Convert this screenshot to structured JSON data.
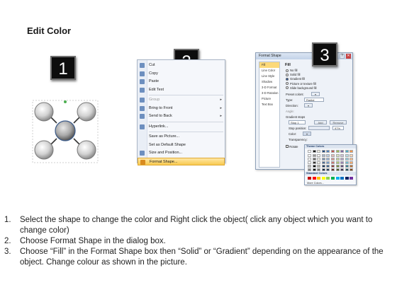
{
  "page": {
    "title": "Edit Color"
  },
  "steps": {
    "one": "1",
    "two": "2",
    "three": "3"
  },
  "context_menu": {
    "items": [
      {
        "label": "Cut",
        "icon": "scissors-icon",
        "arrow": false,
        "disabled": false,
        "highlight": false
      },
      {
        "label": "Copy",
        "icon": "copy-icon",
        "arrow": false,
        "disabled": false,
        "highlight": false
      },
      {
        "label": "Paste",
        "icon": "paste-icon",
        "arrow": false,
        "disabled": false,
        "highlight": false
      },
      {
        "label": "Edit Text",
        "icon": "text-icon",
        "arrow": false,
        "disabled": false,
        "highlight": false
      },
      {
        "label": "Group",
        "icon": "group-icon",
        "arrow": true,
        "disabled": true,
        "highlight": false
      },
      {
        "label": "Bring to Front",
        "icon": "bring-front-icon",
        "arrow": true,
        "disabled": false,
        "highlight": false
      },
      {
        "label": "Send to Back",
        "icon": "send-back-icon",
        "arrow": true,
        "disabled": false,
        "highlight": false
      },
      {
        "label": "Hyperlink...",
        "icon": "hyperlink-icon",
        "arrow": false,
        "disabled": false,
        "highlight": false
      },
      {
        "label": "Save as Picture...",
        "icon": "",
        "arrow": false,
        "disabled": false,
        "highlight": false
      },
      {
        "label": "Set as Default Shape",
        "icon": "",
        "arrow": false,
        "disabled": false,
        "highlight": false
      },
      {
        "label": "Size and Position...",
        "icon": "size-icon",
        "arrow": false,
        "disabled": false,
        "highlight": false
      },
      {
        "label": "Format Shape...",
        "icon": "format-shape-icon",
        "arrow": false,
        "disabled": false,
        "highlight": true
      }
    ]
  },
  "format_dialog": {
    "title": "Format Shape",
    "categories": [
      "Fill",
      "Line Color",
      "Line Style",
      "Shadow",
      "3-D Format",
      "3-D Rotation",
      "Picture",
      "Text Box"
    ],
    "heading": "Fill",
    "options": [
      "No fill",
      "Solid fill",
      "Gradient fill",
      "Picture or texture fill",
      "Slide background fill"
    ],
    "selected_option": "Gradient fill",
    "preset_label": "Preset colors:",
    "type_label": "Type:",
    "type_value": "Radial",
    "direction_label": "Direction:",
    "angle_label": "Angle:",
    "stops_label": "Gradient stops",
    "stop_value": "Stop 1",
    "add_label": "Add",
    "remove_label": "Remove",
    "stop_position_label": "Stop position:",
    "stop_position_value": "97%",
    "color_label": "Color:",
    "transparency_label": "Transparency:",
    "rotate_label": "Rotate"
  },
  "palette": {
    "theme_label": "Theme Colors",
    "standard_label": "Standard Colors",
    "more_label": "More Colors...",
    "theme_colors": [
      "#ffffff",
      "#000000",
      "#eeece1",
      "#1f497d",
      "#4f81bd",
      "#c0504d",
      "#9bbb59",
      "#8064a2",
      "#4bacc6",
      "#f79646"
    ],
    "standard_colors": [
      "#c00000",
      "#ff0000",
      "#ffc000",
      "#ffff00",
      "#92d050",
      "#00b050",
      "#00b0f0",
      "#0070c0",
      "#002060",
      "#7030a0"
    ]
  },
  "instructions": [
    {
      "num": "1.",
      "text": "Select the shape to change the color and Right click the object( click any object which you want to change color)"
    },
    {
      "num": "2.",
      "text": "Choose Format Shape in the dialog box."
    },
    {
      "num": "3.",
      "text": "Choose “Fill” in the Format Shape box then “Solid” or “Gradient” depending on the appearance of the object. Change colour as shown in the picture."
    }
  ]
}
